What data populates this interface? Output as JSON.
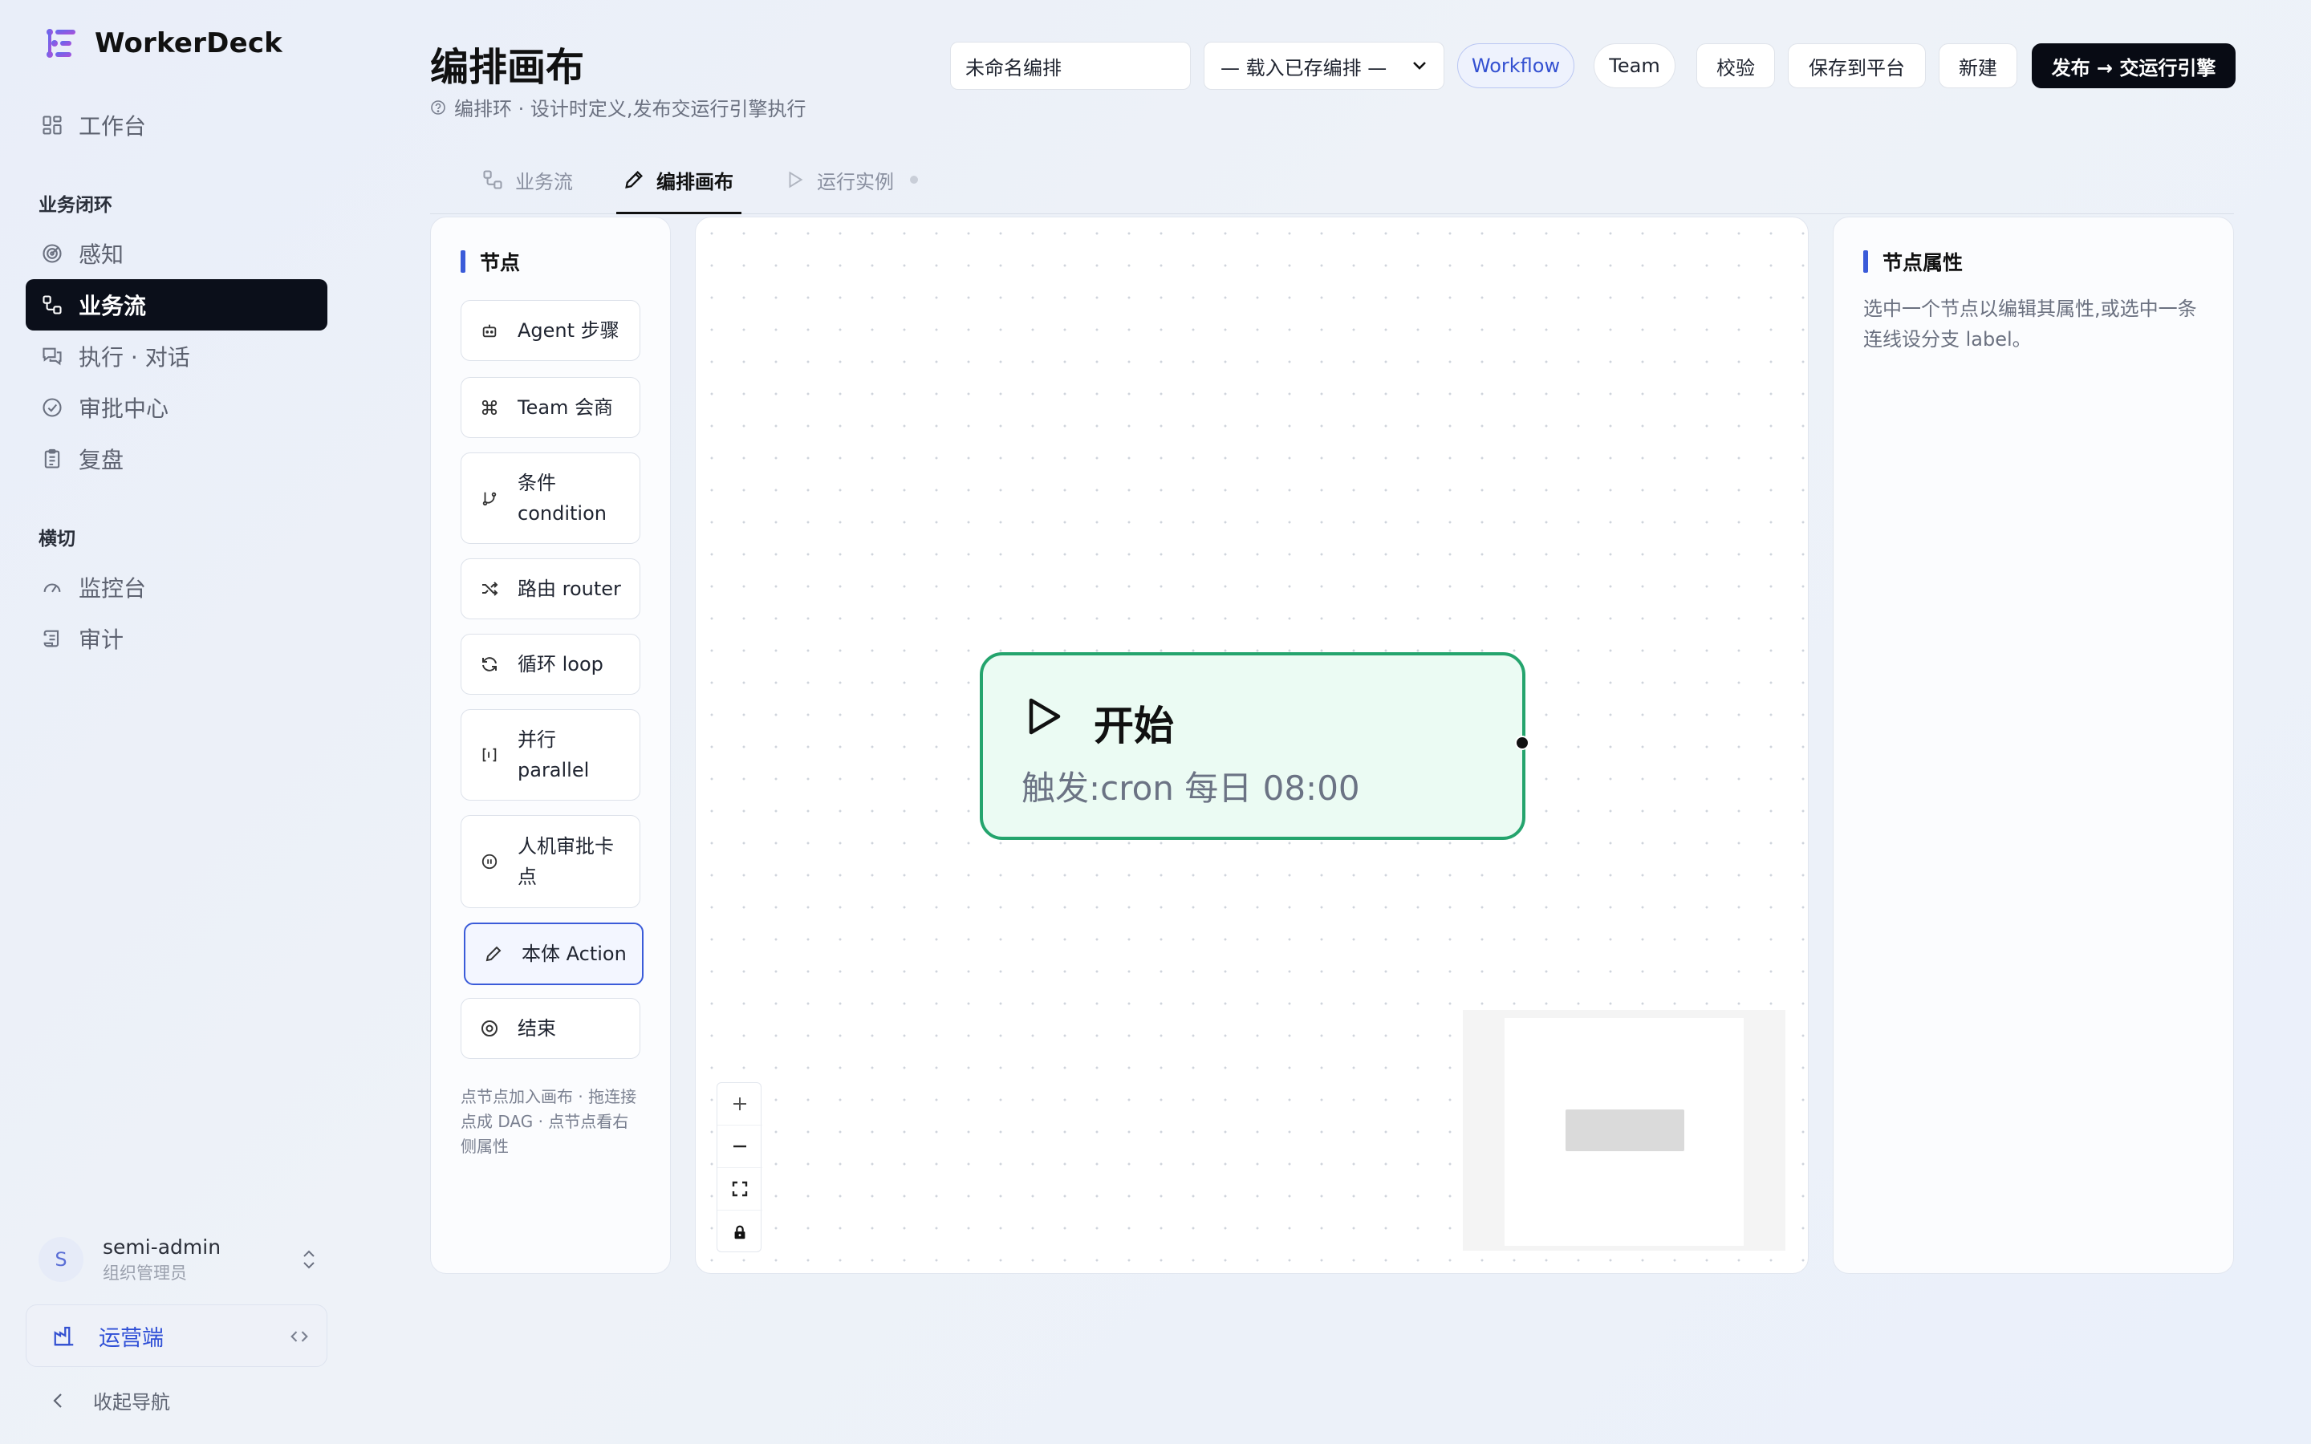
{
  "app": {
    "name": "WorkerDeck"
  },
  "sidebar": {
    "dashboard": "工作台",
    "section_loop": "业务闭环",
    "loop_items": [
      "感知",
      "业务流",
      "执行 · 对话",
      "审批中心",
      "复盘"
    ],
    "section_cross": "横切",
    "cross_items": [
      "监控台",
      "审计"
    ],
    "user": {
      "avatar_letter": "S",
      "name": "semi-admin",
      "role": "组织管理员"
    },
    "ops_label": "运营端",
    "collapse_label": "收起导航"
  },
  "header": {
    "title": "编排画布",
    "subtitle": "编排环 · 设计时定义,发布交运行引擎执行",
    "name_input_value": "未命名编排",
    "load_select": "— 载入已存编排 —",
    "mode_workflow": "Workflow",
    "mode_team": "Team",
    "validate": "校验",
    "save": "保存到平台",
    "new": "新建",
    "publish": "发布 → 交运行引擎"
  },
  "tabs": [
    "业务流",
    "编排画布",
    "运行实例"
  ],
  "palette": {
    "title": "节点",
    "items": [
      "Agent 步骤",
      "Team 会商",
      "条件 condition",
      "路由 router",
      "循环 loop",
      "并行 parallel",
      "人机审批卡点",
      "本体 Action",
      "结束"
    ],
    "hint": "点节点加入画布 · 拖连接点成 DAG · 点节点看右侧属性"
  },
  "canvas": {
    "start_node": {
      "title": "开始",
      "trigger": "触发:cron 每日 08:00"
    }
  },
  "properties": {
    "title": "节点属性",
    "hint": "选中一个节点以编辑其属性,或选中一条连线设分支 label。"
  },
  "colors": {
    "accent": "#3a5bd9",
    "active_nav": "#0b0f1a",
    "start_node_border": "#24a46d",
    "start_node_fill": "#ebfbf3"
  }
}
